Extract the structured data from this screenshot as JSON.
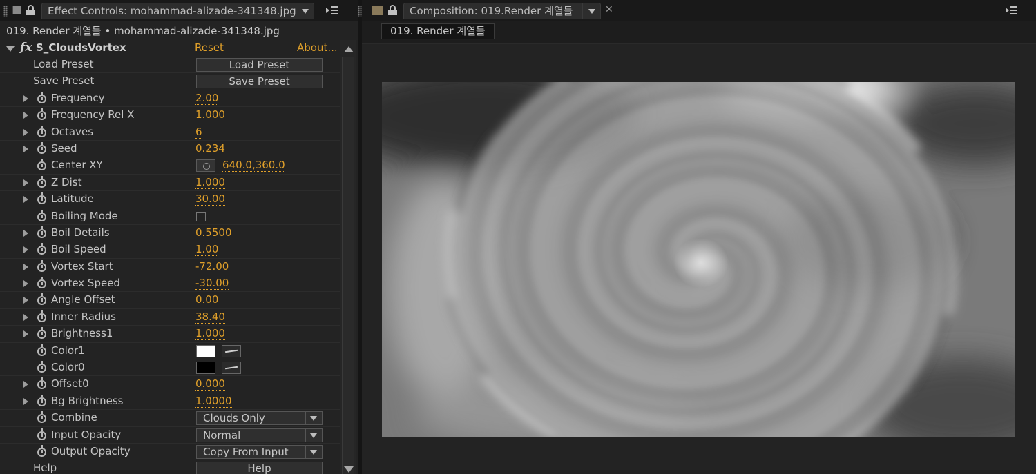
{
  "effect_controls": {
    "tab_title": "Effect Controls: mohammad-alizade-341348.jpg",
    "layer_path": "019. Render 계열들 • mohammad-alizade-341348.jpg",
    "effect": {
      "name": "S_CloudsVortex",
      "reset_label": "Reset",
      "about_label": "About..."
    },
    "load_preset": {
      "label": "Load Preset",
      "button": "Load Preset"
    },
    "save_preset": {
      "label": "Save Preset",
      "button": "Save Preset"
    },
    "params": [
      {
        "label": "Frequency",
        "value": "2.00"
      },
      {
        "label": "Frequency Rel X",
        "value": "1.000"
      },
      {
        "label": "Octaves",
        "value": "6"
      },
      {
        "label": "Seed",
        "value": "0.234"
      },
      {
        "label": "Center XY",
        "value": "640.0,360.0"
      },
      {
        "label": "Z Dist",
        "value": "1.000"
      },
      {
        "label": "Latitude",
        "value": "30.00"
      },
      {
        "label": "Boiling Mode",
        "checked": false
      },
      {
        "label": "Boil Details",
        "value": "0.5500"
      },
      {
        "label": "Boil Speed",
        "value": "1.00"
      },
      {
        "label": "Vortex Start",
        "value": "-72.00"
      },
      {
        "label": "Vortex Speed",
        "value": "-30.00"
      },
      {
        "label": "Angle Offset",
        "value": "0.00"
      },
      {
        "label": "Inner Radius",
        "value": "38.40"
      },
      {
        "label": "Brightness1",
        "value": "1.000"
      },
      {
        "label": "Color1",
        "color": "#ffffff"
      },
      {
        "label": "Color0",
        "color": "#000000"
      },
      {
        "label": "Offset0",
        "value": "0.000"
      },
      {
        "label": "Bg Brightness",
        "value": "1.0000"
      },
      {
        "label": "Combine",
        "selected": "Clouds Only"
      },
      {
        "label": "Input Opacity",
        "selected": "Normal"
      },
      {
        "label": "Output Opacity",
        "selected": "Copy From Input"
      }
    ],
    "help": {
      "label": "Help",
      "button": "Help"
    }
  },
  "composition": {
    "tab_title": "Composition: 019.Render 계열들",
    "flow_chip": "019. Render 계열들"
  },
  "colors": {
    "accent_value": "#e0a02a",
    "panel_bg": "#232323"
  }
}
